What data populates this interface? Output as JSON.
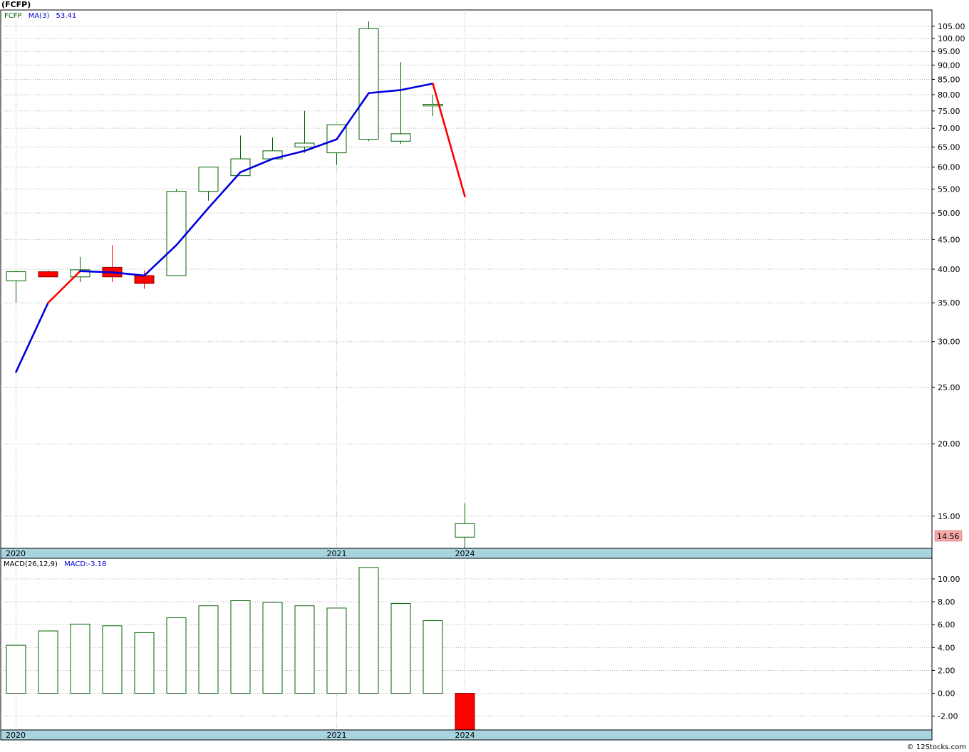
{
  "title": "(FCFP)",
  "copyright": "© 12Stocks.com",
  "colors": {
    "up": "#006400",
    "down": "#ff0000",
    "ma_up": "#0000dd",
    "ma_down": "#ff0000",
    "axis_band": "#a8d4e0",
    "last_badge": "#f5a8a8",
    "grid": "#b0b0b0"
  },
  "price_panel": {
    "legend_symbol": "FCFP",
    "legend_ma": "MA(3)",
    "legend_ma_value": "53.41",
    "y_ticks": [
      "105.00",
      "100.00",
      "95.00",
      "90.00",
      "85.00",
      "80.00",
      "75.00",
      "70.00",
      "65.00",
      "60.00",
      "55.00",
      "50.00",
      "45.00",
      "40.00",
      "35.00",
      "30.00",
      "25.00",
      "20.00",
      "15.00"
    ],
    "last_price": "14.56",
    "x_labels": [
      "2020",
      "2021",
      "2024"
    ]
  },
  "macd_panel": {
    "legend_name": "MACD(26,12,9)",
    "legend_value": "MACD:-3.18",
    "y_ticks": [
      "10.00",
      "8.00",
      "6.00",
      "4.00",
      "2.00",
      "0.00",
      "-2.00"
    ],
    "x_labels": [
      "2020",
      "2021",
      "2024"
    ]
  },
  "chart_data": [
    {
      "type": "candlestick",
      "scale": "log",
      "ylim": [
        13.2,
        112
      ],
      "grid": true,
      "x_tick_labels": [
        {
          "label": "2020",
          "index": 0
        },
        {
          "label": "2021",
          "index": 10
        },
        {
          "label": "2024",
          "index": 14
        }
      ],
      "candles": [
        {
          "open": 38.2,
          "high": 39.8,
          "low": 35.0,
          "close": 39.6
        },
        {
          "open": 39.6,
          "high": 39.8,
          "low": 38.8,
          "close": 38.8
        },
        {
          "open": 38.8,
          "high": 42.0,
          "low": 38.0,
          "close": 39.9
        },
        {
          "open": 40.3,
          "high": 44.0,
          "low": 38.0,
          "close": 38.8
        },
        {
          "open": 39.0,
          "high": 39.8,
          "low": 37.0,
          "close": 37.8
        },
        {
          "open": 39.0,
          "high": 55.0,
          "low": 39.0,
          "close": 54.5
        },
        {
          "open": 54.5,
          "high": 60.0,
          "low": 52.5,
          "close": 60.0
        },
        {
          "open": 58.0,
          "high": 68.0,
          "low": 58.0,
          "close": 62.0
        },
        {
          "open": 62.0,
          "high": 67.5,
          "low": 61.8,
          "close": 64.0
        },
        {
          "open": 65.0,
          "high": 75.0,
          "low": 63.5,
          "close": 66.0
        },
        {
          "open": 63.5,
          "high": 71.0,
          "low": 60.5,
          "close": 71.0
        },
        {
          "open": 67.0,
          "high": 107.0,
          "low": 66.5,
          "close": 104.0
        },
        {
          "open": 66.5,
          "high": 91.0,
          "low": 65.8,
          "close": 68.5
        },
        {
          "open": 76.5,
          "high": 80.0,
          "low": 73.5,
          "close": 77.0
        },
        {
          "open": 13.8,
          "high": 15.8,
          "low": 13.2,
          "close": 14.56
        }
      ],
      "series": [
        {
          "name": "MA(3)",
          "values": [
            26.6,
            35.0,
            39.7,
            39.5,
            39.0,
            44.0,
            51.0,
            58.8,
            62.0,
            64.0,
            67.0,
            80.5,
            81.5,
            83.6,
            53.41
          ]
        }
      ]
    },
    {
      "type": "bar",
      "ylim": [
        -3.2,
        11.8
      ],
      "grid": true,
      "x_tick_labels": [
        {
          "label": "2020",
          "index": 0
        },
        {
          "label": "2021",
          "index": 10
        },
        {
          "label": "2024",
          "index": 14
        }
      ],
      "values": [
        4.2,
        5.45,
        6.05,
        5.9,
        5.3,
        6.6,
        7.65,
        8.1,
        7.95,
        7.65,
        7.45,
        11.0,
        7.85,
        6.35,
        -3.18
      ]
    }
  ]
}
